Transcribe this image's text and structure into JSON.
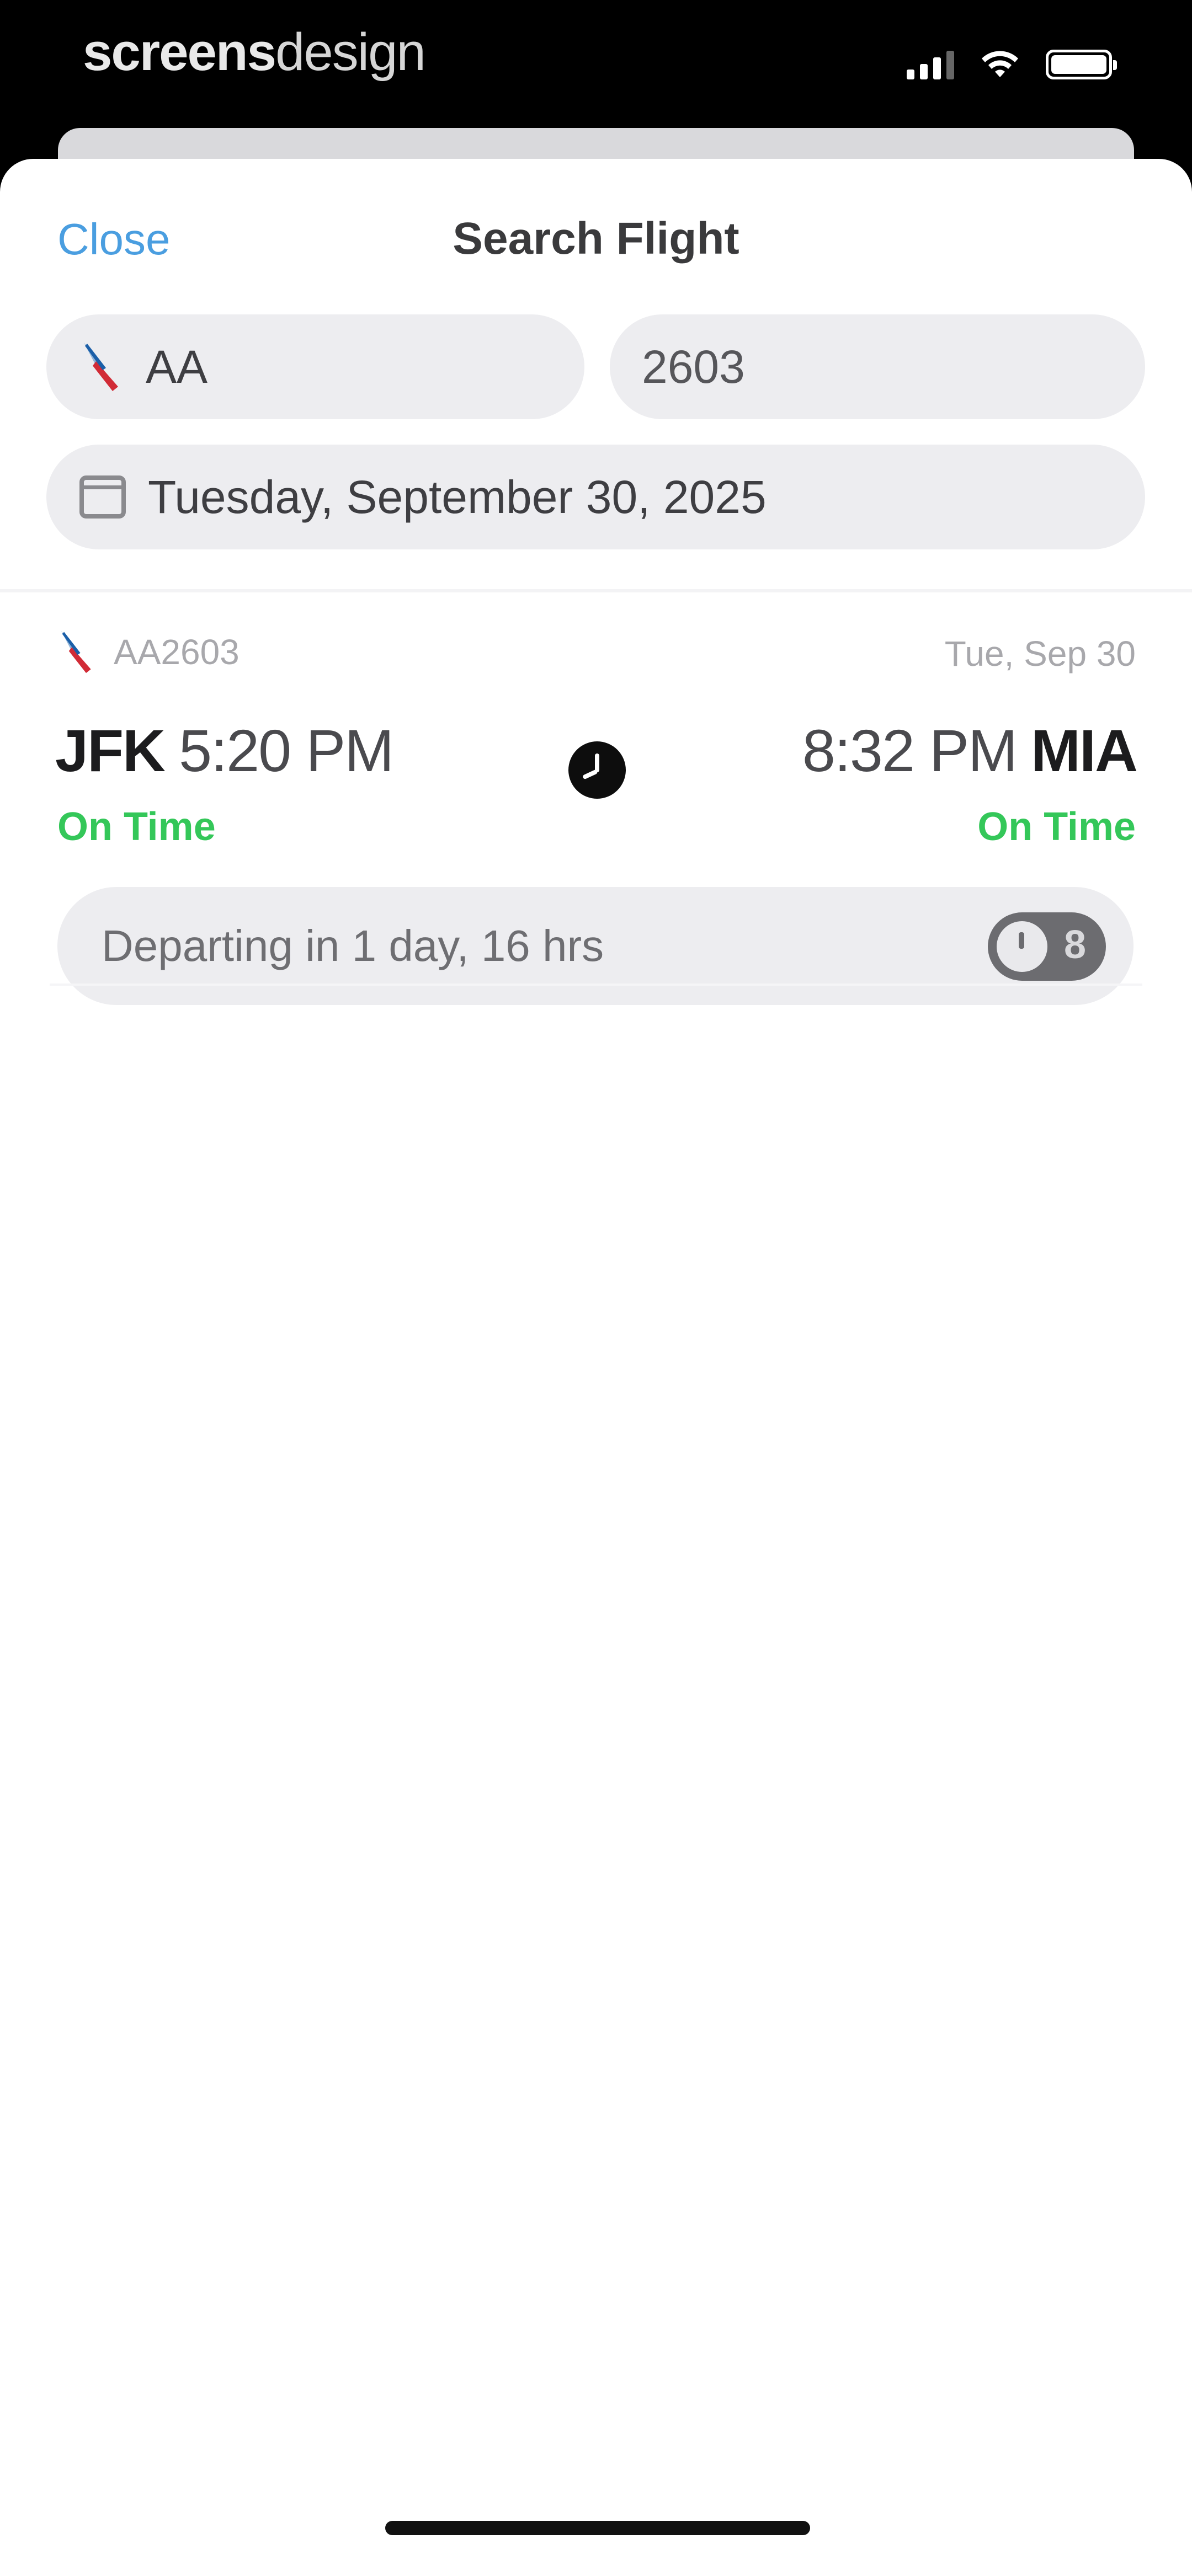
{
  "status_bar": {
    "brand_bold": "screens",
    "brand_light": "design",
    "icons": [
      "signal-icon",
      "wifi-icon",
      "battery-icon"
    ]
  },
  "nav": {
    "close_label": "Close",
    "title": "Search Flight"
  },
  "search": {
    "airline_value": "AA",
    "flight_number_value": "2603",
    "date_value": "Tuesday, September 30, 2025"
  },
  "result": {
    "flight_code": "AA2603",
    "date_short": "Tue, Sep 30",
    "departure": {
      "airport": "JFK",
      "time": "5:20 PM",
      "status": "On Time"
    },
    "arrival": {
      "airport": "MIA",
      "time": "8:32 PM",
      "status": "On Time"
    },
    "departing_text": "Departing in 1 day, 16 hrs",
    "toggle_badge": "8"
  },
  "colors": {
    "accent": "#4a9ee0",
    "on_time": "#34c759",
    "field_bg": "#ededf0"
  }
}
